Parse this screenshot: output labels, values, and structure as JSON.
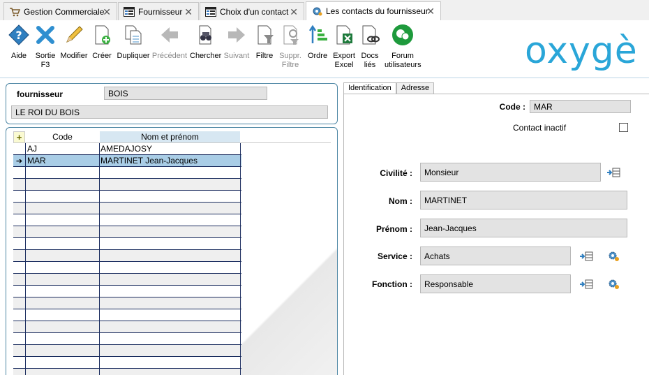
{
  "tabs": [
    {
      "label": "Gestion Commerciale",
      "icon": "cart-icon"
    },
    {
      "label": "Fournisseur",
      "icon": "window-icon"
    },
    {
      "label": "Choix d'un contact",
      "icon": "window-icon"
    },
    {
      "label": "Les contacts du fournisseur",
      "icon": "gear-icon"
    }
  ],
  "toolbar": {
    "aide": "Aide",
    "sortie_1": "Sortie",
    "sortie_2": "F3",
    "modifier": "Modifier",
    "creer": "Créer",
    "dupliquer": "Dupliquer",
    "precedent": "Précédent",
    "chercher": "Chercher",
    "suivant": "Suivant",
    "filtre": "Filtre",
    "suppr_1": "Suppr.",
    "suppr_2": "Filtre",
    "ordre": "Ordre",
    "export_1": "Export",
    "export_2": "Excel",
    "docs_1": "Docs",
    "docs_2": "liés",
    "forum_1": "Forum",
    "forum_2": "utilisateurs"
  },
  "logo": "oxygè",
  "supplier": {
    "label": "fournisseur",
    "code": "BOIS",
    "name": "LE ROI DU BOIS"
  },
  "grid": {
    "add_symbol": "+",
    "col_code": "Code",
    "col_nom": "Nom et prénom",
    "rows": [
      {
        "code": "AJ",
        "nom": "AMEDAJOSY",
        "marker": ""
      },
      {
        "code": "MAR",
        "nom": "MARTINET Jean-Jacques",
        "marker": "➔"
      }
    ]
  },
  "form": {
    "tab_identification": "Identification",
    "tab_adresse": "Adresse",
    "code_label": "Code :",
    "code_value": "MAR",
    "inactif_label": "Contact inactif",
    "civilite_label": "Civilité :",
    "civilite_value": "Monsieur",
    "nom_label": "Nom :",
    "nom_value": "MARTINET",
    "prenom_label": "Prénom :",
    "prenom_value": "Jean-Jacques",
    "service_label": "Service :",
    "service_value": "Achats",
    "fonction_label": "Fonction :",
    "fonction_value": "Responsable"
  },
  "colors": {
    "accent": "#2aa6d8",
    "selection": "#a9cde6",
    "panel_border": "#4d86a4"
  }
}
